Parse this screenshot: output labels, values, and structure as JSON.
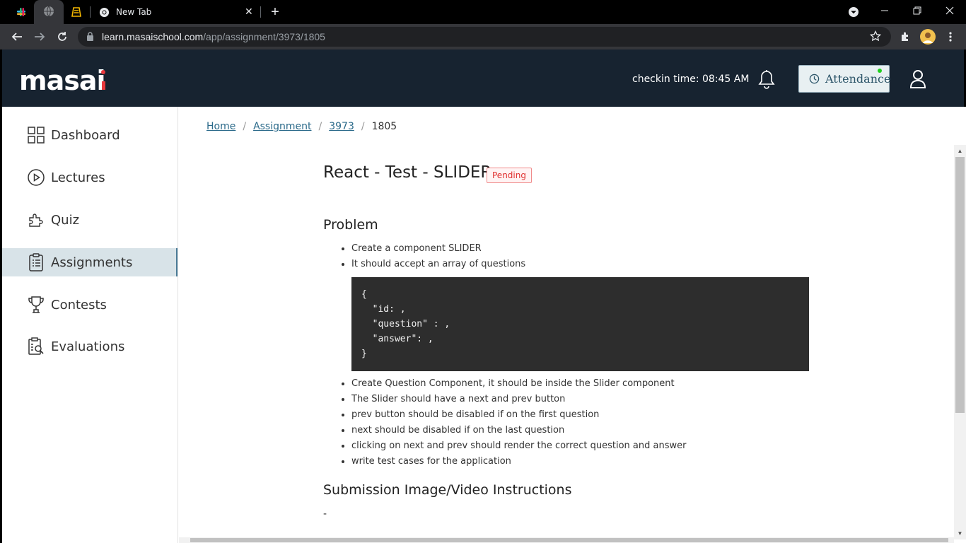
{
  "browser": {
    "tabs": [
      {
        "icon": "slack-icon"
      },
      {
        "icon": "globe-icon"
      },
      {
        "icon": "notebook-icon"
      },
      {
        "icon": "chrome-icon",
        "label": "New Tab"
      }
    ],
    "url_domain": "learn.masaischool.com",
    "url_path": "/app/assignment/3973/1805"
  },
  "header": {
    "logo": "masai",
    "checkin_text": "checkin time: 08:45 AM",
    "attendance_label": "Attendance"
  },
  "sidebar": {
    "items": [
      {
        "label": "Dashboard",
        "icon": "dashboard-icon"
      },
      {
        "label": "Lectures",
        "icon": "play-icon"
      },
      {
        "label": "Quiz",
        "icon": "puzzle-icon"
      },
      {
        "label": "Assignments",
        "icon": "clipboard-icon",
        "active": true
      },
      {
        "label": "Contests",
        "icon": "trophy-icon"
      },
      {
        "label": "Evaluations",
        "icon": "evaluation-icon"
      }
    ]
  },
  "breadcrumb": {
    "home": "Home",
    "assignment": "Assignment",
    "id": "3973",
    "current": "1805",
    "separator": "/"
  },
  "assignment": {
    "title": "React - Test - SLIDER",
    "status": "Pending",
    "problem_heading": "Problem",
    "bullets_1": [
      "Create a component SLIDER",
      "It should accept an array of questions"
    ],
    "code_lines": [
      "{",
      "  \"id: ,",
      "  \"question\" : ,",
      "  \"answer\": ,",
      "}"
    ],
    "bullets_2": [
      "Create Question Component, it should be inside the Slider component",
      "The Slider should have a next and prev button",
      "prev button should be disabled if on the first question",
      "next should be disabled if on the last question",
      "clicking on next and prev should render the correct question and answer",
      "write test cases for the application"
    ],
    "submission_heading": "Submission Image/Video Instructions",
    "submission_text": "-"
  },
  "colors": {
    "header_bg": "#172330",
    "active_nav_bg": "#d8e3e8",
    "badge_red": "#e0302f",
    "code_bg": "#2d2d2d"
  }
}
